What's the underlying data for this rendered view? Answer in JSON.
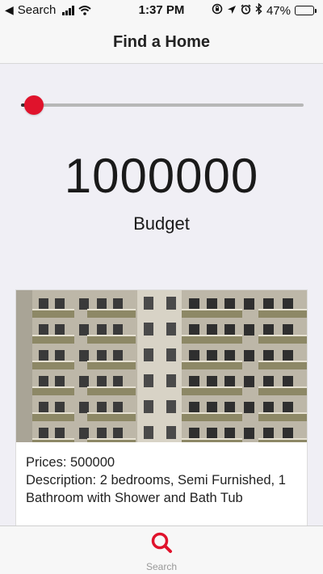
{
  "status_bar": {
    "back_label": "Search",
    "time": "1:37 PM",
    "battery_percent": "47%",
    "battery_level": 0.47
  },
  "nav": {
    "title": "Find a Home"
  },
  "slider": {
    "fraction": 0.0,
    "accent_color": "#e0132c"
  },
  "budget": {
    "value": "1000000",
    "label": "Budget"
  },
  "listing": {
    "price_line": "Prices: 500000",
    "description_line": "Description: 2 bedrooms, Semi Furnished, 1 Bathroom with Shower and Bath Tub"
  },
  "tab_bar": {
    "items": [
      {
        "label": "Search",
        "icon": "search-icon",
        "color": "#e0132c"
      }
    ]
  }
}
